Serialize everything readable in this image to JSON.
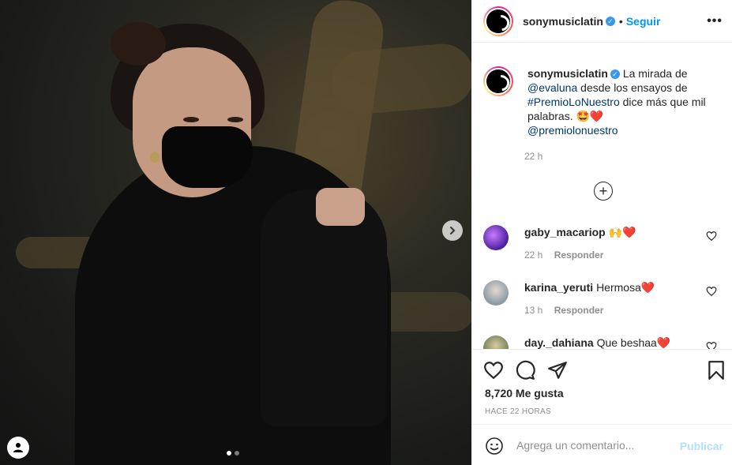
{
  "post": {
    "username": "sonymusiclatin",
    "follow_label": "Seguir",
    "more_label": "•••",
    "caption": {
      "intro": "La mirada de",
      "mention": "@evaluna",
      "mid": "desde los ensayos de",
      "hashtag": "#PremioLoNuestro",
      "end": "dice más que mil palabras. 🤩❤️",
      "mention2": "@premiolonuestro"
    },
    "time_ago": "22 h",
    "load_more_symbol": "+"
  },
  "comments": [
    {
      "username": "gaby_macariop",
      "text": "🙌❤️",
      "time": "22 h",
      "reply_label": "Responder",
      "avatar_color": "#6a3bd4"
    },
    {
      "username": "karina_yeruti",
      "text": "Hermosa❤️",
      "time": "13 h",
      "reply_label": "Responder",
      "avatar_color": "#b7c2c9"
    },
    {
      "username": "day._dahiana",
      "text": "Que beshaa❤️",
      "time": "",
      "reply_label": "",
      "avatar_color": "#8fa078"
    }
  ],
  "actions": {
    "likes": "8,720 Me gusta",
    "ago": "HACE 22 HORAS"
  },
  "add_comment": {
    "placeholder": "Agrega un comentario...",
    "publish_label": "Publicar"
  },
  "colors": {
    "accent": "#0095f6",
    "verified": "#3897f0",
    "publish_disabled": "#b2dffc"
  },
  "carousel": {
    "current": 1,
    "total": 2
  }
}
